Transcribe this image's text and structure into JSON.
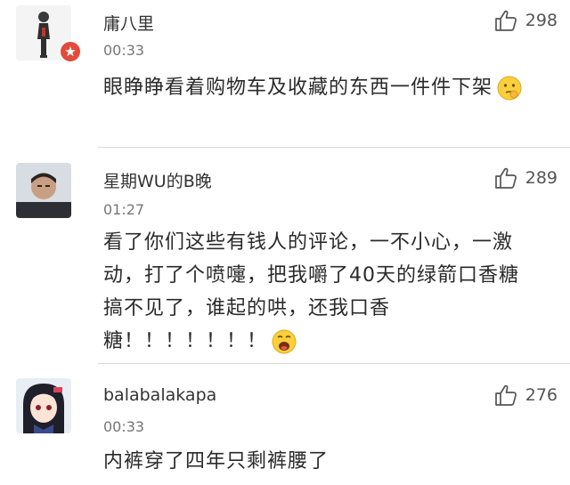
{
  "comments": [
    {
      "username": "庸八里",
      "time": "00:33",
      "likes": "298",
      "text": "眼睁睁看着购物车及收藏的东西一件件下架",
      "emoji": "thinking-emoji",
      "badge": "star-badge-icon"
    },
    {
      "username": "星期WU的B晚",
      "time": "01:27",
      "likes": "289",
      "text": "看了你们这些有钱人的评论，一不小心，一激动，打了个喷嚏，把我嚼了40天的绿箭口香糖搞不见了，谁起的哄，还我口香糖！！！！！！！",
      "emoji": "crying-emoji"
    },
    {
      "username": "balabalakapa",
      "time": "00:33",
      "likes": "276",
      "text": "内裤穿了四年只剩裤腰了"
    }
  ],
  "colors": {
    "badge": "#e24a3b",
    "divider": "#d9d9d9",
    "name": "#333333",
    "time": "#777777"
  }
}
